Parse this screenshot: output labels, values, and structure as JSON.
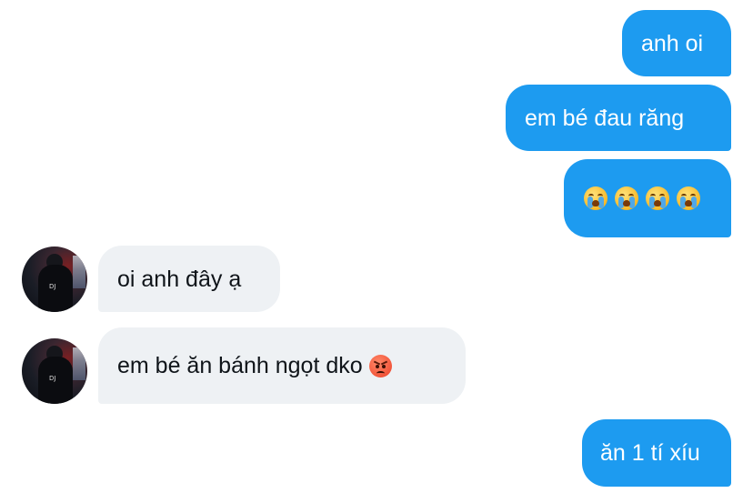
{
  "messages": [
    {
      "id": "m1",
      "direction": "outgoing",
      "text": "anh oi"
    },
    {
      "id": "m2",
      "direction": "outgoing",
      "text": "em bé đau răng"
    },
    {
      "id": "m3",
      "direction": "outgoing",
      "emojis": [
        "loudly-crying-face",
        "loudly-crying-face",
        "loudly-crying-face",
        "loudly-crying-face"
      ]
    },
    {
      "id": "m4",
      "direction": "incoming",
      "text": "oi anh đây ạ"
    },
    {
      "id": "m5",
      "direction": "incoming",
      "text": "em bé ăn bánh ngọt dko",
      "emoji": "angry-face"
    },
    {
      "id": "m6",
      "direction": "outgoing",
      "text": "ăn 1 tí xíu"
    }
  ],
  "colors": {
    "outgoing_bubble": "#1d9bf0",
    "incoming_bubble": "#eef1f4",
    "outgoing_text": "#ffffff",
    "incoming_text": "#0f1419",
    "background": "#ffffff"
  },
  "avatar_logo_text": "DJ"
}
